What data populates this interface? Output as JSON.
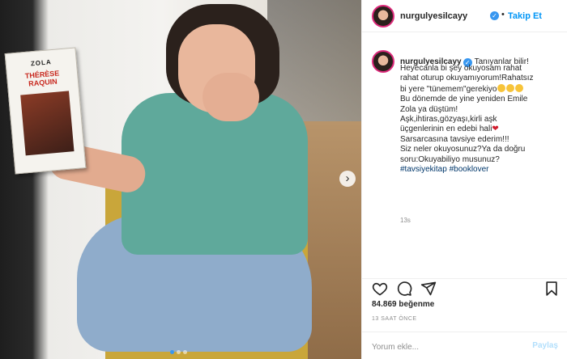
{
  "post": {
    "username": "nurgulyesilcayy",
    "follow_label": "Takip Et",
    "bullet": "•",
    "book": {
      "author": "ZOLA",
      "title": "THÉRÈSE RAQUIN"
    },
    "next_glyph": "›",
    "caption_first": "Tanıyanlar bilir!",
    "caption_lines": [
      "Heyecanla bi şey okuyosam rahat",
      "rahat oturup okuyamıyorum!Rahatsız",
      "bi yere \"tünemem\"gerekiyo",
      "Bu dönemde de yine yeniden Emile",
      "Zola ya düştüm!",
      "Aşk,ihtiras,gözyaşı,kirli aşk",
      "üçgenlerinin en edebi hali",
      "Sarsarcasına tavsiye ederim!!!",
      "Siz neler okuyosunuz?Ya da doğru",
      "soru:Okuyabiliyo musunuz?"
    ],
    "hashtags": "#tavsiyekitap #booklover",
    "time_short": "13s",
    "likes": "84.869 beğenme",
    "time_ago": "13 SAAT ÖNCE",
    "comment_placeholder": "Yorum ekle...",
    "post_button": "Paylaş",
    "verified_glyph": "✓",
    "heart_glyph": "❤",
    "colors": {
      "link_blue": "#0095f6",
      "verified_blue": "#3897f0",
      "hashtag_blue": "#00376b",
      "muted": "#8e8e8e",
      "post_disabled": "#b2dffc"
    }
  }
}
